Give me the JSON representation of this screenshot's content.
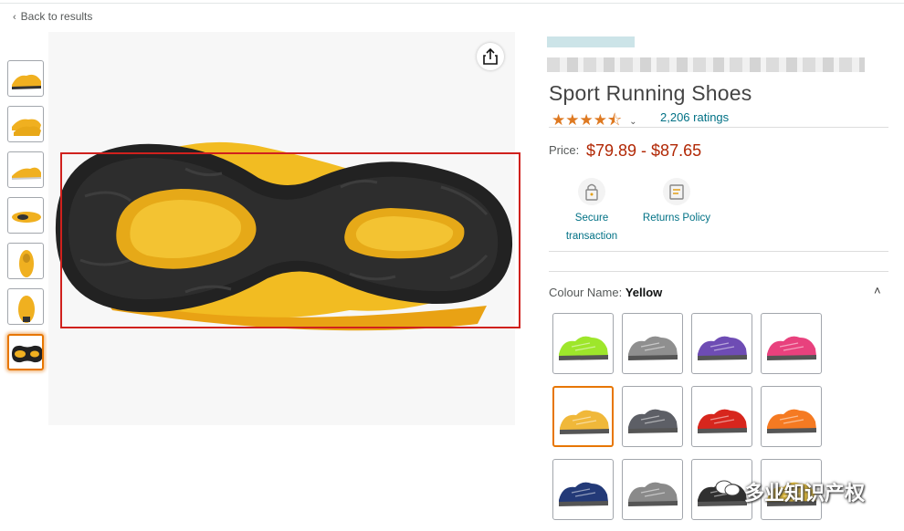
{
  "nav": {
    "back_label": "Back to results"
  },
  "thumbnails": [
    {
      "view": "side-left",
      "color": "#f0b020"
    },
    {
      "view": "pair",
      "color": "#f0b020"
    },
    {
      "view": "side-right",
      "color": "#f0b020"
    },
    {
      "view": "top",
      "color": "#f0b020"
    },
    {
      "view": "front",
      "color": "#f0b020"
    },
    {
      "view": "back",
      "color": "#f0b020"
    },
    {
      "view": "sole",
      "color": "#f0b020",
      "active": true
    }
  ],
  "main_image": {
    "description_icon": "sole-image",
    "share_icon": "share-icon"
  },
  "product": {
    "title": "Sport Running Shoes",
    "rating_stars": "★★★★⯪",
    "ratings_count": "2,206 ratings",
    "price_label": "Price:",
    "price_value": "$79.89 - $87.65",
    "features": [
      {
        "label_line1": "Secure",
        "label_line2": "transaction",
        "icon": "lock-icon"
      },
      {
        "label_line1": "Returns Policy",
        "label_line2": "",
        "icon": "returns-icon"
      }
    ]
  },
  "colour": {
    "label": "Colour Name:",
    "selected": "Yellow",
    "swatches": [
      {
        "color": "#9ee62b"
      },
      {
        "color": "#8f8f8f"
      },
      {
        "color": "#6e4cb4"
      },
      {
        "color": "#e8417d"
      },
      {
        "color": "#f0b83a",
        "selected": true
      },
      {
        "color": "#5d5f66"
      },
      {
        "color": "#d7261d"
      },
      {
        "color": "#f57a22"
      },
      {
        "color": "#233a78"
      },
      {
        "color": "#8a8a8a"
      },
      {
        "color": "#303030"
      },
      {
        "color": "#e8c13c"
      }
    ]
  },
  "watermark": {
    "text": "多业知识产权"
  },
  "colors": {
    "accent": "#e77600",
    "link": "#007185",
    "price": "#b12704",
    "star": "#de7921",
    "highlight": "#d0211d"
  }
}
